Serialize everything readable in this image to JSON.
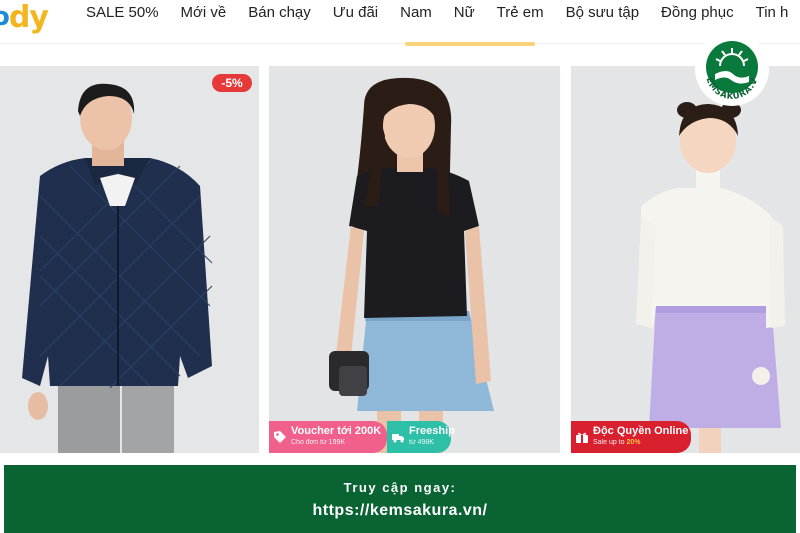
{
  "nav": {
    "logo_text": "dy",
    "items": [
      "SALE 50%",
      "Mới về",
      "Bán chạy",
      "Ưu đãi",
      "Nam",
      "Nữ",
      "Trẻ em",
      "Bộ sưu tập",
      "Đồng phục",
      "Tin h"
    ]
  },
  "products": {
    "men_jacket": {
      "discount_badge": "-5%"
    },
    "women_tshirt": {
      "voucher": {
        "title": "Voucher tới 200K",
        "sub": "Cho đơn từ 199K"
      },
      "freeship": {
        "title": "Freeship",
        "sub": "từ 498K"
      }
    },
    "kids_top": {
      "exclusive": {
        "title": "Độc Quyền Online",
        "sub_prefix": "Sale up to ",
        "sub_value": "20%"
      }
    }
  },
  "watermark": {
    "text": "KEMSAKURA.VN"
  },
  "banner": {
    "line1": "Truy cập ngay:",
    "line2": "https://kemsakura.vn/"
  },
  "colors": {
    "banner_bg": "#0a6333",
    "discount_red": "#e63a3a",
    "voucher_pink": "#f0608a",
    "freeship_teal": "#2dbfa8",
    "exclusive_red": "#d8202f",
    "logo_yellow": "#f5b51e"
  },
  "icons": {
    "voucher": "tag-icon",
    "freeship": "truck-icon",
    "exclusive": "gift-icon"
  }
}
